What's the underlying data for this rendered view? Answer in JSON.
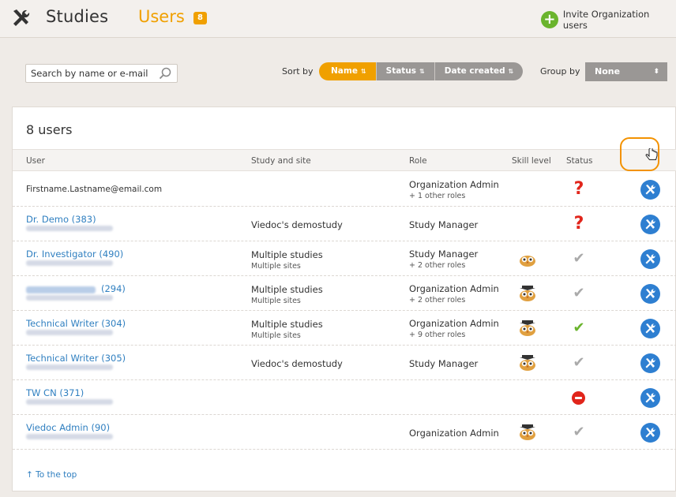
{
  "header": {
    "nav_studies": "Studies",
    "nav_users": "Users",
    "users_badge": "8",
    "invite_label": "Invite Organization users"
  },
  "toolbar": {
    "search_placeholder": "Search by name or e-mail",
    "sort_by_label": "Sort by",
    "sort_options": [
      "Name",
      "Status",
      "Date created"
    ],
    "sort_active": "Name",
    "group_by_label": "Group by",
    "group_by_value": "None"
  },
  "panel": {
    "title": "8 users",
    "columns": [
      "User",
      "Study and site",
      "Role",
      "Skill level",
      "Status"
    ],
    "to_top_label": "To the top"
  },
  "users": [
    {
      "name": "Firstname.Lastname@email.com",
      "study": "",
      "site": "",
      "role": "Organization Admin",
      "role_extra": "+ 1 other roles",
      "skill": "",
      "status": "unknown"
    },
    {
      "name": "Dr. Demo (383)",
      "study": "Viedoc's demostudy",
      "site": "",
      "role": "Study Manager",
      "role_extra": "",
      "skill": "",
      "status": "unknown"
    },
    {
      "name": "Dr. Investigator (490)",
      "study": "Multiple studies",
      "site": "Multiple sites",
      "role": "Study Manager",
      "role_extra": "+ 2 other roles",
      "skill": "beginner",
      "status": "inactive"
    },
    {
      "name": "(294)",
      "study": "Multiple studies",
      "site": "Multiple sites",
      "role": "Organization Admin",
      "role_extra": "+ 2 other roles",
      "skill": "expert",
      "status": "inactive"
    },
    {
      "name": "Technical Writer (304)",
      "study": "Multiple studies",
      "site": "Multiple sites",
      "role": "Organization Admin",
      "role_extra": "+ 9 other roles",
      "skill": "expert",
      "status": "active"
    },
    {
      "name": "Technical Writer (305)",
      "study": "Viedoc's demostudy",
      "site": "",
      "role": "Study Manager",
      "role_extra": "",
      "skill": "expert",
      "status": "inactive"
    },
    {
      "name": "TW CN (371)",
      "study": "",
      "site": "",
      "role": "",
      "role_extra": "",
      "skill": "",
      "status": "blocked"
    },
    {
      "name": "Viedoc Admin (90)",
      "study": "",
      "site": "",
      "role": "Organization Admin",
      "role_extra": "",
      "skill": "expert",
      "status": "inactive"
    }
  ]
}
